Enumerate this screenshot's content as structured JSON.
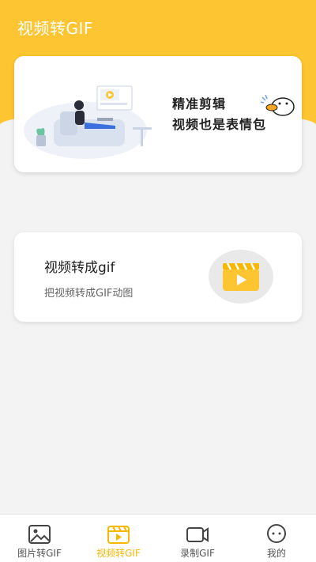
{
  "app": {
    "title": "视频转GIF"
  },
  "banner": {
    "line1": "精准剪辑",
    "line2": "视频也是表情包"
  },
  "feature": {
    "title": "视频转成gif",
    "desc": "把视频转成GIF动图"
  },
  "tabs": [
    {
      "label": "图片转GIF",
      "icon": "image-icon",
      "active": false
    },
    {
      "label": "视频转GIF",
      "icon": "video-clapper-icon",
      "active": true
    },
    {
      "label": "录制GIF",
      "icon": "camera-record-icon",
      "active": false
    },
    {
      "label": "我的",
      "icon": "chat-bubble-icon",
      "active": false
    }
  ],
  "colors": {
    "accent": "#fcc531",
    "active_tab": "#f6b800",
    "background": "#f3f3f3"
  }
}
